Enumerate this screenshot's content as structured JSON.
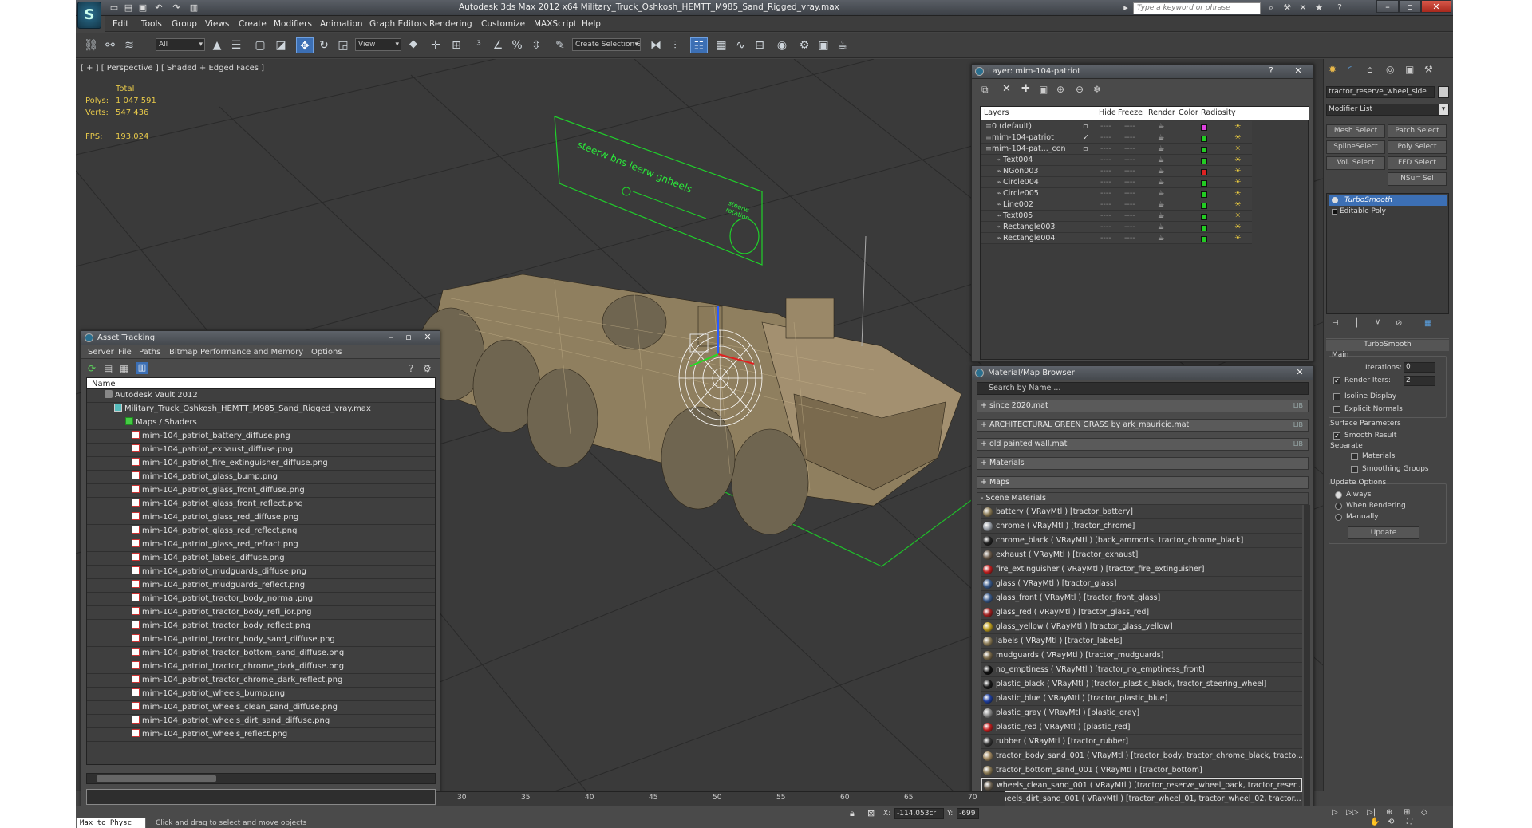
{
  "titlebar": {
    "title": "Autodesk 3ds Max  2012 x64      Military_Truck_Oshkosh_HEMTT_M985_Sand_Rigged_vray.max",
    "search_placeholder": "Type a keyword or phrase"
  },
  "menu": [
    "Edit",
    "Tools",
    "Group",
    "Views",
    "Create",
    "Modifiers",
    "Animation",
    "Graph Editors",
    "Rendering",
    "Customize",
    "MAXScript",
    "Help"
  ],
  "toolbar": {
    "selection_filter": "All",
    "reference_coord": "View",
    "named_selection": "Create Selection Se"
  },
  "viewport": {
    "label": "[ + ] [ Perspective ] [ Shaded + Edged Faces ]",
    "stats": {
      "total_label": "Total",
      "polys_label": "Polys:",
      "polys_value": "1 047 591",
      "verts_label": "Verts:",
      "verts_value": "547 436",
      "fps_label": "FPS:",
      "fps_value": "193,024"
    },
    "sign_text": "steerw bns leerw gnheels",
    "sign_small": "steerw\nrotation"
  },
  "asset_tracking": {
    "title": "Asset Tracking",
    "menu": [
      "Server",
      "File",
      "Paths",
      "Bitmap Performance and Memory",
      "Options"
    ],
    "column": "Name",
    "vault": "Autodesk Vault 2012",
    "file": "Military_Truck_Oshkosh_HEMTT_M985_Sand_Rigged_vray.max",
    "folder": "Maps / Shaders",
    "maps": [
      "mim-104_patriot_battery_diffuse.png",
      "mim-104_patriot_exhaust_diffuse.png",
      "mim-104_patriot_fire_extinguisher_diffuse.png",
      "mim-104_patriot_glass_bump.png",
      "mim-104_patriot_glass_front_diffuse.png",
      "mim-104_patriot_glass_front_reflect.png",
      "mim-104_patriot_glass_red_diffuse.png",
      "mim-104_patriot_glass_red_reflect.png",
      "mim-104_patriot_glass_red_refract.png",
      "mim-104_patriot_labels_diffuse.png",
      "mim-104_patriot_mudguards_diffuse.png",
      "mim-104_patriot_mudguards_reflect.png",
      "mim-104_patriot_tractor_body_normal.png",
      "mim-104_patriot_tractor_body_refl_ior.png",
      "mim-104_patriot_tractor_body_reflect.png",
      "mim-104_patriot_tractor_body_sand_diffuse.png",
      "mim-104_patriot_tractor_bottom_sand_diffuse.png",
      "mim-104_patriot_tractor_chrome_dark_diffuse.png",
      "mim-104_patriot_tractor_chrome_dark_reflect.png",
      "mim-104_patriot_wheels_bump.png",
      "mim-104_patriot_wheels_clean_sand_diffuse.png",
      "mim-104_patriot_wheels_dirt_sand_diffuse.png",
      "mim-104_patriot_wheels_reflect.png"
    ]
  },
  "layers": {
    "title": "Layer: mim-104-patriot",
    "headers": {
      "layers": "Layers",
      "hide": "Hide",
      "freeze": "Freeze",
      "render": "Render",
      "color": "Color",
      "radiosity": "Radiosity"
    },
    "rows": [
      {
        "name": "0 (default)",
        "color": "#e040e0",
        "indent": 0
      },
      {
        "name": "mim-104-patriot",
        "color": "#22cc22",
        "indent": 0
      },
      {
        "name": "mim-104-pat..._con",
        "color": "#22cc22",
        "indent": 0
      },
      {
        "name": "Text004",
        "color": "#22cc22",
        "indent": 1
      },
      {
        "name": "NGon003",
        "color": "#dd2222",
        "indent": 1
      },
      {
        "name": "Circle004",
        "color": "#22cc22",
        "indent": 1
      },
      {
        "name": "Circle005",
        "color": "#22cc22",
        "indent": 1
      },
      {
        "name": "Line002",
        "color": "#22cc22",
        "indent": 1
      },
      {
        "name": "Text005",
        "color": "#22cc22",
        "indent": 1
      },
      {
        "name": "Rectangle003",
        "color": "#22cc22",
        "indent": 1
      },
      {
        "name": "Rectangle004",
        "color": "#22cc22",
        "indent": 1
      }
    ]
  },
  "material_browser": {
    "title": "Material/Map Browser",
    "search_placeholder": "Search by Name ...",
    "libraries": [
      {
        "name": "+ since 2020.mat",
        "tag": "LIB"
      },
      {
        "name": "+ ARCHITECTURAL GREEN GRASS by ark_mauricio.mat",
        "tag": "LIB"
      },
      {
        "name": "+ old painted wall.mat",
        "tag": "LIB"
      },
      {
        "name": "+ Materials",
        "tag": ""
      },
      {
        "name": "+ Maps",
        "tag": ""
      },
      {
        "name": "- Scene Materials",
        "tag": ""
      }
    ],
    "scene_materials": [
      {
        "label": "battery  ( VRayMtl )  [tractor_battery]",
        "color": "#8a7a55"
      },
      {
        "label": "chrome  ( VRayMtl )  [tractor_chrome]",
        "color": "#9aa0a8"
      },
      {
        "label": "chrome_black  ( VRayMtl )  [back_ammorts, tractor_chrome_black]",
        "color": "#222222"
      },
      {
        "label": "exhaust  ( VRayMtl )  [tractor_exhaust]",
        "color": "#6a5a4a"
      },
      {
        "label": "fire_extinguisher  ( VRayMtl )  [tractor_fire_extinguisher]",
        "color": "#c02020"
      },
      {
        "label": "glass  ( VRayMtl )  [tractor_glass]",
        "color": "#3a5a8a"
      },
      {
        "label": "glass_front  ( VRayMtl )  [tractor_front_glass]",
        "color": "#3a5a8a"
      },
      {
        "label": "glass_red  ( VRayMtl )  [tractor_glass_red]",
        "color": "#a02020"
      },
      {
        "label": "glass_yellow  ( VRayMtl )  [tractor_glass_yellow]",
        "color": "#c0a020"
      },
      {
        "label": "labels  ( VRayMtl )  [tractor_labels]",
        "color": "#8a7a55"
      },
      {
        "label": "mudguards  ( VRayMtl )  [tractor_mudguards]",
        "color": "#7a6a4a"
      },
      {
        "label": "no_emptiness  ( VRayMtl )  [tractor_no_emptiness_front]",
        "color": "#111111"
      },
      {
        "label": "plastic_black  ( VRayMtl )  [tractor_plastic_black, tractor_steering_wheel]",
        "color": "#1a1a1a"
      },
      {
        "label": "plastic_blue  ( VRayMtl )  [tractor_plastic_blue]",
        "color": "#2040a0"
      },
      {
        "label": "plastic_gray  ( VRayMtl )  [plastic_gray]",
        "color": "#8a8a8a"
      },
      {
        "label": "plastic_red  ( VRayMtl )  [plastic_red]",
        "color": "#c02020"
      },
      {
        "label": "rubber  ( VRayMtl )  [tractor_rubber]",
        "color": "#333333"
      },
      {
        "label": "tractor_body_sand_001  ( VRayMtl )  [tractor_body, tractor_chrome_black, tracto...",
        "color": "#a08860"
      },
      {
        "label": "tractor_bottom_sand_001  ( VRayMtl )  [tractor_bottom]",
        "color": "#8a7a55"
      },
      {
        "label": "wheels_clean_sand_001  ( VRayMtl )  [tractor_reserve_wheel_back, tractor_reser...",
        "color": "#6a6050",
        "selected": true
      },
      {
        "label": "wheels_dirt_sand_001  ( VRayMtl )  [tractor_wheel_01, tractor_wheel_02, tractor...",
        "color": "#6a6050"
      }
    ]
  },
  "command_panel": {
    "object_name": "tractor_reserve_wheel_side",
    "modifier_list": "Modifier List",
    "buttons": [
      "Mesh Select",
      "Patch Select",
      "SplineSelect",
      "Poly Select",
      "Vol. Select",
      "FFD Select",
      "NSurf Sel"
    ],
    "stack": [
      "TurboSmooth",
      "Editable Poly"
    ],
    "rollout_title": "TurboSmooth",
    "main_label": "Main",
    "iterations_label": "Iterations:",
    "iterations_value": "0",
    "render_iters_label": "Render Iters:",
    "render_iters_value": "2",
    "isoline_label": "Isoline Display",
    "explicit_label": "Explicit Normals",
    "surface_label": "Surface Parameters",
    "smooth_result_label": "Smooth Result",
    "separate_label": "Separate",
    "materials_label": "Materials",
    "smoothing_groups_label": "Smoothing Groups",
    "update_options_label": "Update Options",
    "always_label": "Always",
    "when_rendering_label": "When Rendering",
    "manually_label": "Manually",
    "update_button": "Update"
  },
  "timeline": {
    "ticks": [
      "30",
      "35",
      "40",
      "45",
      "50",
      "55",
      "60",
      "65",
      "70"
    ]
  },
  "status": {
    "maxscript": "Max to Physc",
    "prompt": "Click and drag to select and move objects",
    "x_label": "X:",
    "x_value": "-114,053cr",
    "y_label": "Y:",
    "y_value": "-699"
  }
}
